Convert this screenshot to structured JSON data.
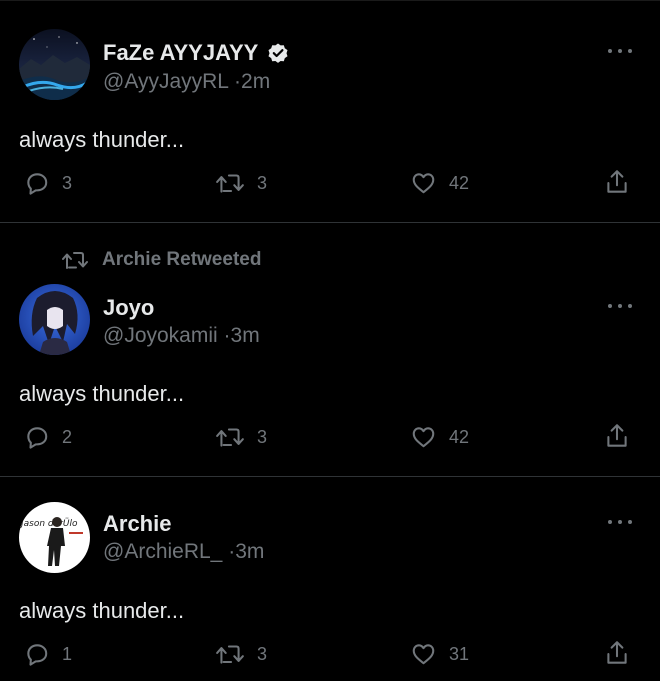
{
  "tweets": [
    {
      "name": "FaZe AYYJAYY",
      "verified": true,
      "handle": "@AyyJayyRL",
      "time": "2m",
      "text": "always thunder...",
      "replies": "3",
      "retweets": "3",
      "likes": "42",
      "avatar": "night-landscape-avatar"
    },
    {
      "retweet_context": "Archie Retweeted",
      "name": "Joyo",
      "verified": false,
      "handle": "@Joyokamii",
      "time": "3m",
      "text": "always thunder...",
      "replies": "2",
      "retweets": "3",
      "likes": "42",
      "avatar": "anime-character-avatar"
    },
    {
      "name": "Archie",
      "verified": false,
      "handle": "@ArchieRL_",
      "time": "3m",
      "text": "always thunder...",
      "replies": "1",
      "retweets": "3",
      "likes": "31",
      "avatar": "jason-derulo-avatar",
      "avatar_text": "Jason derÜlo"
    }
  ],
  "separator": "·",
  "colors": {
    "background": "#000000",
    "text_primary": "#e7e9ea",
    "text_secondary": "#71767b",
    "divider": "#2f3336",
    "verified_badge": "#e7e9ea"
  }
}
